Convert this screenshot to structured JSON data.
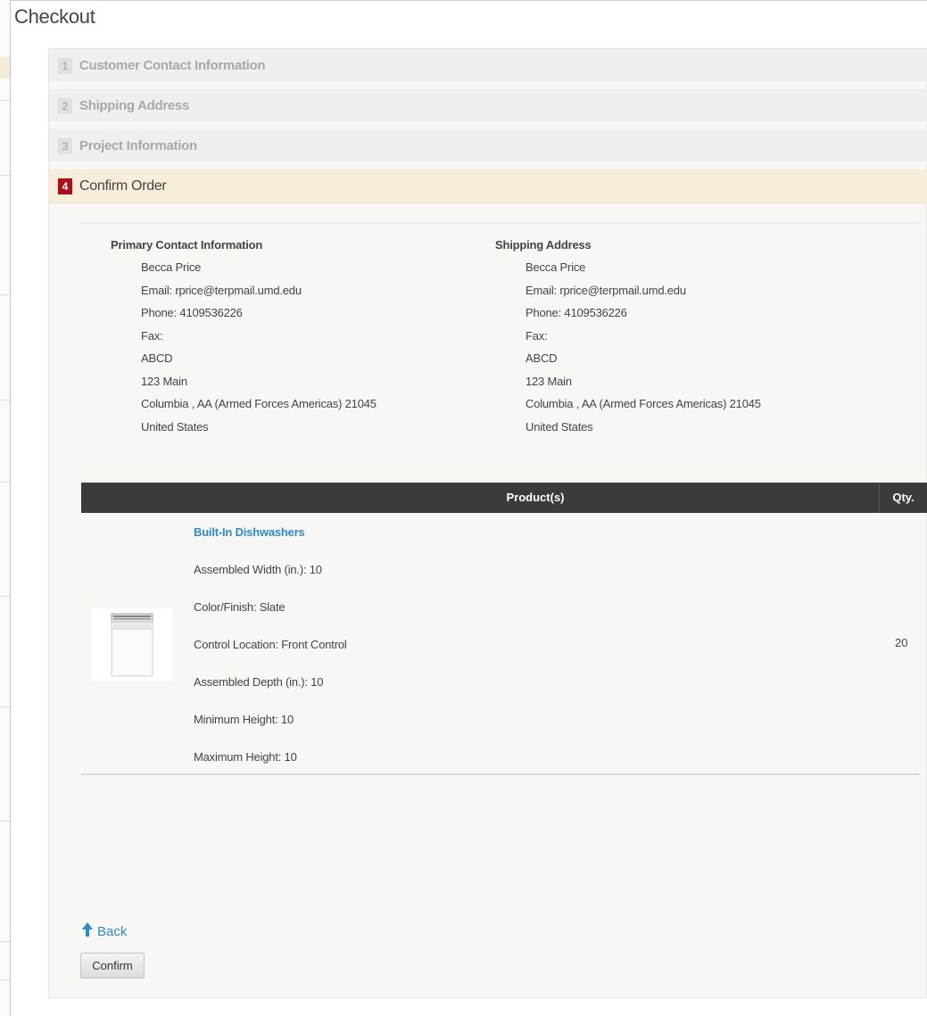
{
  "page_title": "Checkout",
  "steps": [
    {
      "number": "1",
      "label": "Customer Contact Information",
      "active": false
    },
    {
      "number": "2",
      "label": "Shipping Address",
      "active": false
    },
    {
      "number": "3",
      "label": "Project Information",
      "active": false
    },
    {
      "number": "4",
      "label": "Confirm Order",
      "active": true
    }
  ],
  "contact": {
    "heading": "Primary Contact Information",
    "lines": [
      "Becca Price",
      "Email: rprice@terpmail.umd.edu",
      "Phone: 4109536226",
      "Fax:",
      "ABCD",
      "123 Main",
      "Columbia , AA (Armed Forces Americas) 21045",
      "United States"
    ]
  },
  "shipping": {
    "heading": "Shipping Address",
    "lines": [
      "Becca Price",
      "Email: rprice@terpmail.umd.edu",
      "Phone: 4109536226",
      "Fax:",
      "ABCD",
      "123 Main",
      "Columbia , AA (Armed Forces Americas) 21045",
      "United States"
    ]
  },
  "table": {
    "products_header": "Product(s)",
    "qty_header": "Qty."
  },
  "product": {
    "name": "Built-In Dishwashers",
    "attributes": [
      "Assembled Width (in.): 10",
      "Color/Finish: Slate",
      "Control Location: Front Control",
      "Assembled Depth (in.): 10",
      "Minimum Height: 10",
      "Maximum Height: 10"
    ],
    "qty": "20",
    "image_icon": "dishwasher-image"
  },
  "actions": {
    "back_label": "Back",
    "confirm_label": "Confirm"
  },
  "colors": {
    "link": "#2a8ccf",
    "active_step_badge": "#b10e14",
    "active_step_bg": "#f6eed9",
    "table_header_bg": "#3b3b3b"
  }
}
